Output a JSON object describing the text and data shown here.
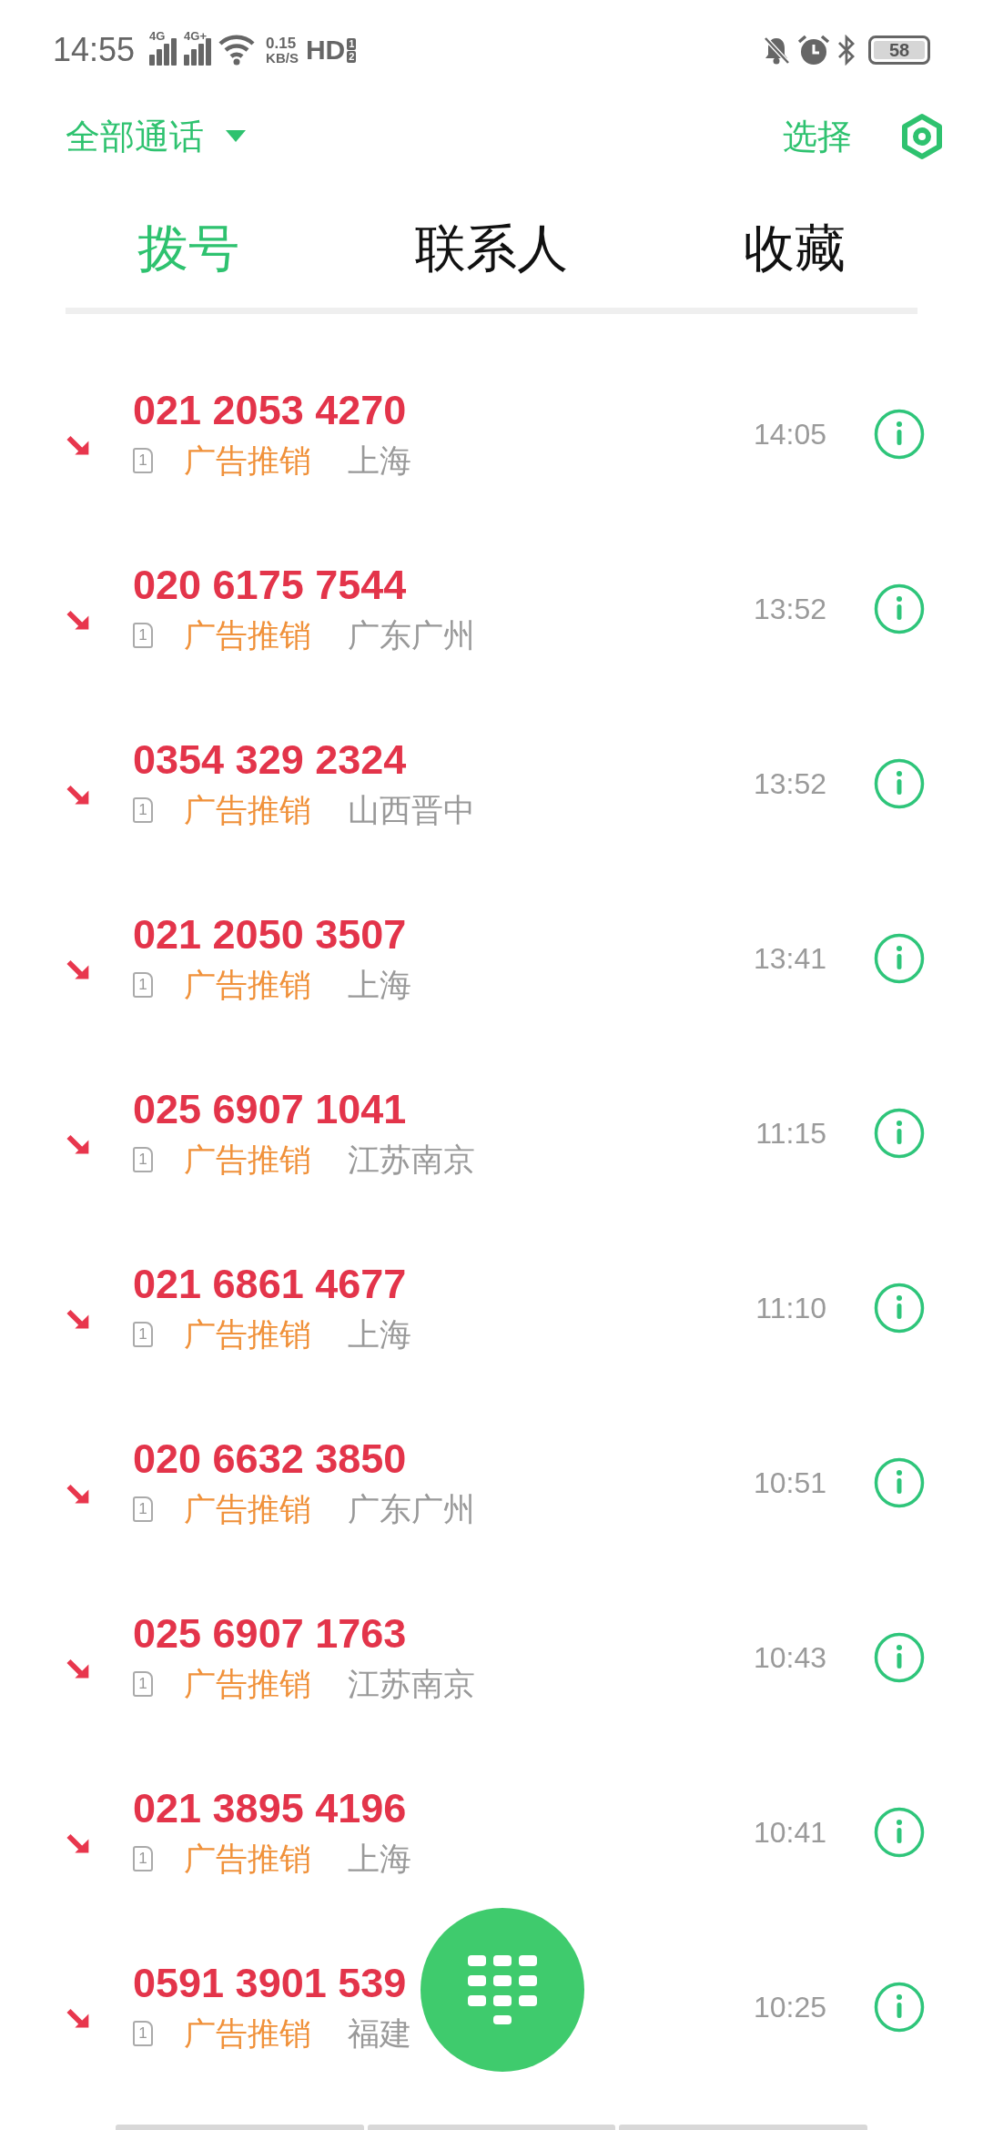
{
  "status_bar": {
    "time": "14:55",
    "signal_1": "4G",
    "signal_2": "4G+",
    "speed_value": "0.15",
    "speed_unit": "KB/S",
    "hd": "HD",
    "hd_sims": [
      "1",
      "2"
    ],
    "battery": "58"
  },
  "header": {
    "filter": "全部通话",
    "select": "选择"
  },
  "tabs": [
    {
      "label": "拨号",
      "selected": true
    },
    {
      "label": "联系人",
      "selected": false
    },
    {
      "label": "收藏",
      "selected": false
    }
  ],
  "calls": [
    {
      "number": "021 2053 4270",
      "sim": "1",
      "tag": "广告推销",
      "location": "上海",
      "time": "14:05"
    },
    {
      "number": "020 6175 7544",
      "sim": "1",
      "tag": "广告推销",
      "location": "广东广州",
      "time": "13:52"
    },
    {
      "number": "0354 329 2324",
      "sim": "1",
      "tag": "广告推销",
      "location": "山西晋中",
      "time": "13:52"
    },
    {
      "number": "021 2050 3507",
      "sim": "1",
      "tag": "广告推销",
      "location": "上海",
      "time": "13:41"
    },
    {
      "number": "025 6907 1041",
      "sim": "1",
      "tag": "广告推销",
      "location": "江苏南京",
      "time": "11:15"
    },
    {
      "number": "021 6861 4677",
      "sim": "1",
      "tag": "广告推销",
      "location": "上海",
      "time": "11:10"
    },
    {
      "number": "020 6632 3850",
      "sim": "1",
      "tag": "广告推销",
      "location": "广东广州",
      "time": "10:51"
    },
    {
      "number": "025 6907 1763",
      "sim": "1",
      "tag": "广告推销",
      "location": "江苏南京",
      "time": "10:43"
    },
    {
      "number": "021 3895 4196",
      "sim": "1",
      "tag": "广告推销",
      "location": "上海",
      "time": "10:41"
    },
    {
      "number": "0591 3901 539",
      "sim": "1",
      "tag": "广告推销",
      "location": "福建",
      "time": "10:25"
    }
  ]
}
